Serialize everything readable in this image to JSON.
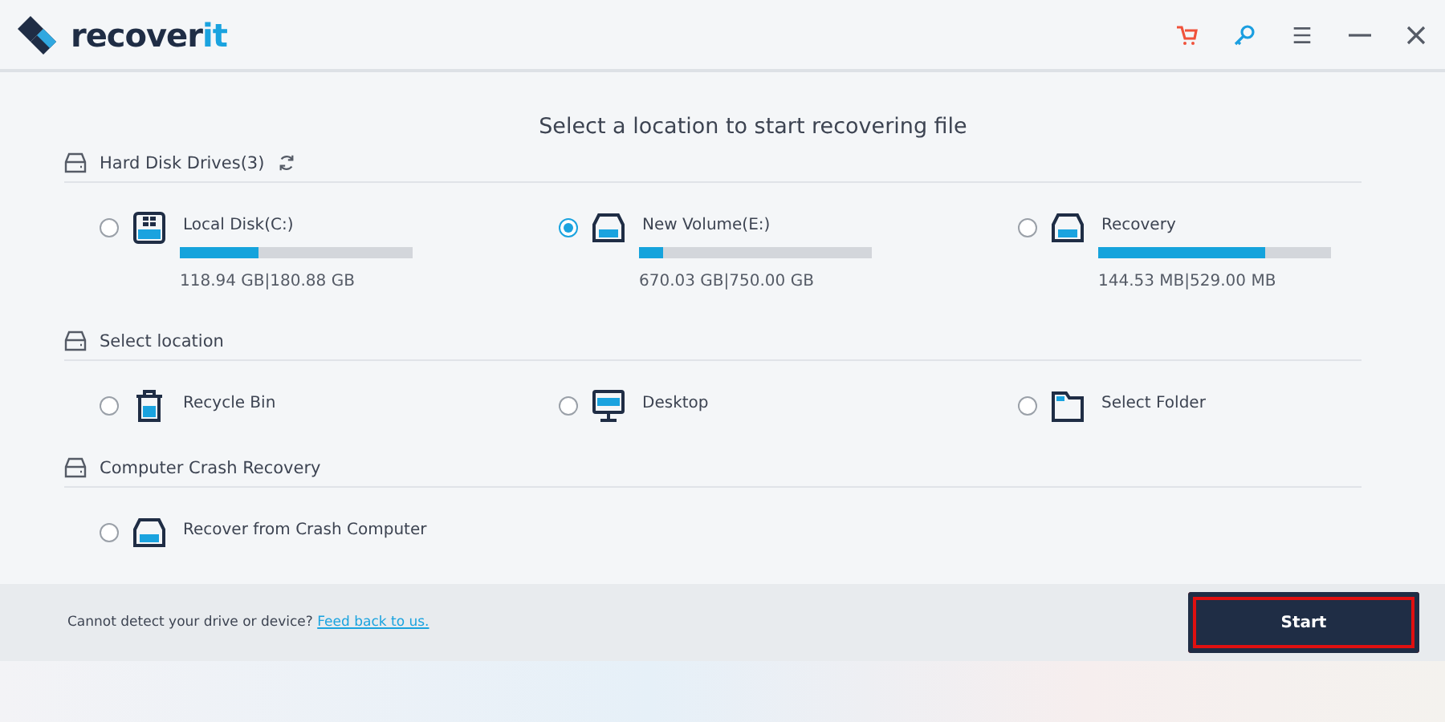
{
  "app": {
    "logo_text": "recover",
    "logo_accent": "it"
  },
  "title": "Select a location to start recovering file",
  "sections": [
    {
      "heading": "Hard Disk Drives(3)",
      "refresh": true,
      "items": [
        {
          "kind": "system_disk",
          "name": "Local Disk(C:)",
          "selected": false,
          "level": 0.34,
          "size": "118.94  GB|180.88  GB"
        },
        {
          "kind": "disk",
          "name": "New Volume(E:)",
          "selected": true,
          "level": 0.1,
          "size": "670.03  GB|750.00  GB"
        },
        {
          "kind": "disk",
          "name": "Recovery",
          "selected": false,
          "level": 0.72,
          "size": "144.53  MB|529.00  MB"
        }
      ]
    },
    {
      "heading": "Select location",
      "refresh": false,
      "items": [
        {
          "kind": "recycle_bin",
          "name": "Recycle Bin",
          "selected": false
        },
        {
          "kind": "desktop",
          "name": "Desktop",
          "selected": false
        },
        {
          "kind": "folder",
          "name": "Select Folder",
          "selected": false
        }
      ]
    },
    {
      "heading": "Computer Crash Recovery",
      "refresh": false,
      "items": [
        {
          "kind": "disk",
          "name": "Recover from Crash Computer",
          "selected": false
        }
      ]
    }
  ],
  "footer": {
    "message": "Cannot detect your drive or device?",
    "link": "Feed back to us."
  },
  "start_button": {
    "label": "Start",
    "highlighted": true
  }
}
